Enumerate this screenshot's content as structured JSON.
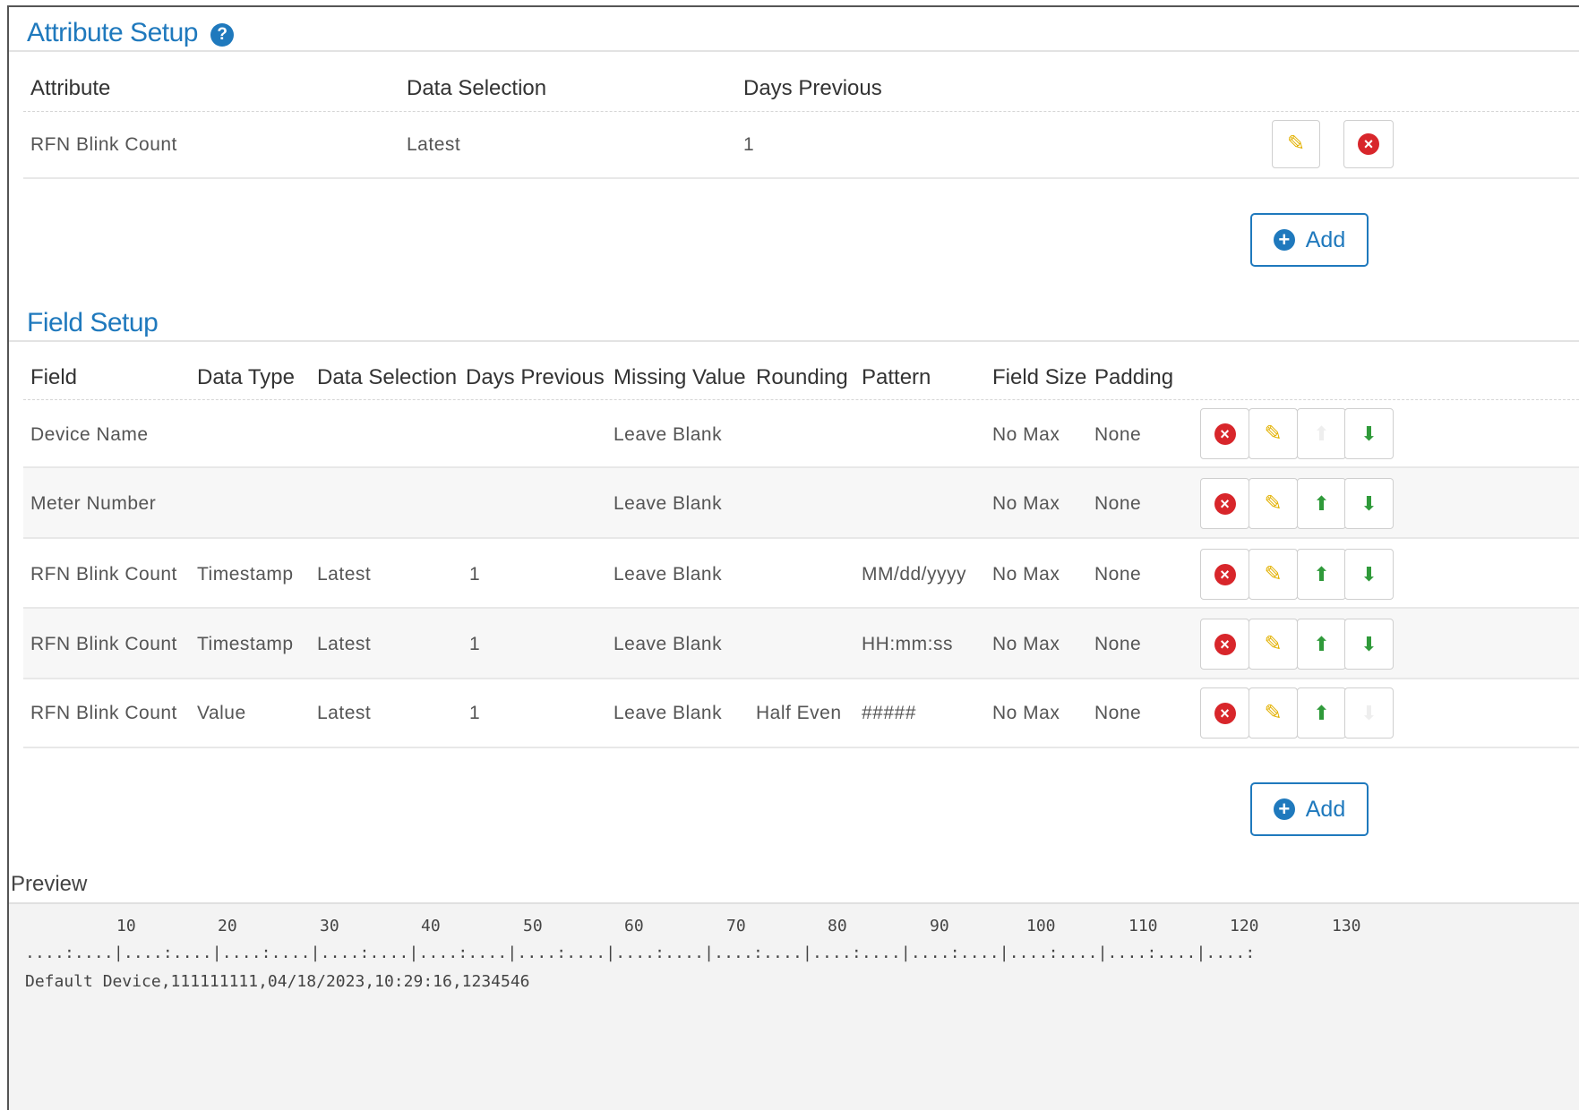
{
  "attribute_setup": {
    "title": "Attribute Setup",
    "help_icon": "?",
    "headers": [
      "Attribute",
      "Data Selection",
      "Days Previous"
    ],
    "rows": [
      {
        "attribute": "RFN Blink Count",
        "data_selection": "Latest",
        "days_previous": "1"
      }
    ],
    "add_label": "Add"
  },
  "field_setup": {
    "title": "Field Setup",
    "headers": [
      "Field",
      "Data Type",
      "Data Selection",
      "Days Previous",
      "Missing Value",
      "Rounding",
      "Pattern",
      "Field Size",
      "Padding"
    ],
    "rows": [
      {
        "field": "Device Name",
        "data_type": "",
        "data_selection": "",
        "days_previous": "",
        "missing_value": "Leave Blank",
        "rounding": "",
        "pattern": "",
        "field_size": "No Max",
        "padding": "None"
      },
      {
        "field": "Meter Number",
        "data_type": "",
        "data_selection": "",
        "days_previous": "",
        "missing_value": "Leave Blank",
        "rounding": "",
        "pattern": "",
        "field_size": "No Max",
        "padding": "None"
      },
      {
        "field": "RFN Blink Count",
        "data_type": "Timestamp",
        "data_selection": "Latest",
        "days_previous": "1",
        "missing_value": "Leave Blank",
        "rounding": "",
        "pattern": "MM/dd/yyyy",
        "field_size": "No Max",
        "padding": "None"
      },
      {
        "field": "RFN Blink Count",
        "data_type": "Timestamp",
        "data_selection": "Latest",
        "days_previous": "1",
        "missing_value": "Leave Blank",
        "rounding": "",
        "pattern": "HH:mm:ss",
        "field_size": "No Max",
        "padding": "None"
      },
      {
        "field": "RFN Blink Count",
        "data_type": "Value",
        "data_selection": "Latest",
        "days_previous": "1",
        "missing_value": "Leave Blank",
        "rounding": "Half Even",
        "pattern": "#####",
        "field_size": "No Max",
        "padding": "None"
      }
    ],
    "add_label": "Add"
  },
  "preview": {
    "label": "Preview",
    "ruler_numbers": [
      "10",
      "20",
      "30",
      "40",
      "50",
      "60",
      "70",
      "80",
      "90",
      "100",
      "110",
      "120",
      "130"
    ],
    "ruler_line": "....:....|....:....|....:....|....:....|....:....|....:....|....:....|....:....|....:....|....:....|....:....|....:....|....:",
    "text": "Default Device,111111111,04/18/2023,10:29:16,1234546"
  },
  "icons": {
    "delete": "close-circle-icon",
    "edit": "pencil-icon",
    "up": "arrow-up-icon",
    "down": "arrow-down-icon",
    "add": "plus-circle-icon",
    "help": "help-circle-icon"
  },
  "colors": {
    "accent": "#1f79bd",
    "delete": "#d8262b",
    "edit": "#e3b100",
    "move": "#2f9a3a"
  }
}
